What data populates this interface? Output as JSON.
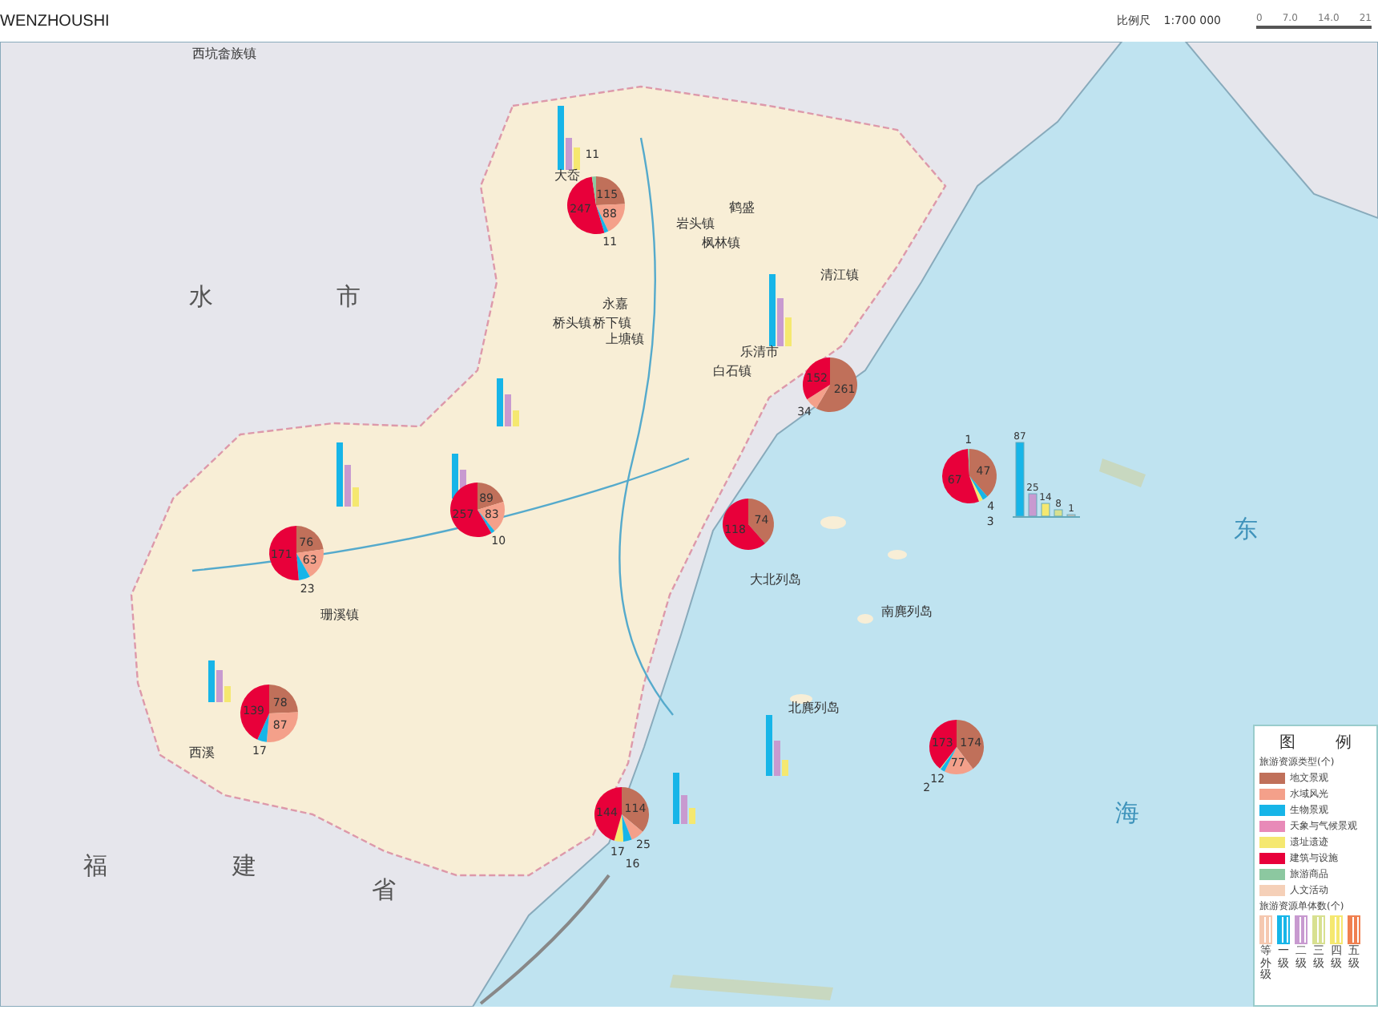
{
  "header": {
    "title": "WENZHOUSHI",
    "scale_label": "比例尺",
    "scale_ratio": "1:700 000",
    "scale_ticks": [
      "0",
      "7.0",
      "14.0",
      "21"
    ]
  },
  "map": {
    "places": [
      {
        "name": "水",
        "kind": "region"
      },
      {
        "name": "市",
        "kind": "region"
      },
      {
        "name": "福",
        "kind": "region"
      },
      {
        "name": "建",
        "kind": "region"
      },
      {
        "name": "省",
        "kind": "region"
      },
      {
        "name": "东",
        "kind": "sea"
      },
      {
        "name": "海",
        "kind": "sea"
      },
      {
        "name": "大岙",
        "kind": "town"
      },
      {
        "name": "岩头镇",
        "kind": "town"
      },
      {
        "name": "枫林镇",
        "kind": "town"
      },
      {
        "name": "鹤盛",
        "kind": "town"
      },
      {
        "name": "桥头镇",
        "kind": "town"
      },
      {
        "name": "桥下镇",
        "kind": "town"
      },
      {
        "name": "永嘉",
        "kind": "town"
      },
      {
        "name": "上塘镇",
        "kind": "town"
      },
      {
        "name": "清江镇",
        "kind": "town"
      },
      {
        "name": "乐清市",
        "kind": "town"
      },
      {
        "name": "白石镇",
        "kind": "town"
      },
      {
        "name": "西坑畲族镇",
        "kind": "town"
      },
      {
        "name": "珊溪镇",
        "kind": "town"
      },
      {
        "name": "西溪",
        "kind": "town"
      },
      {
        "name": "大北列岛",
        "kind": "town"
      },
      {
        "name": "北麂列岛",
        "kind": "town"
      },
      {
        "name": "南麂列岛",
        "kind": "town"
      }
    ],
    "pies": [
      {
        "chart_data": {
          "type": "pie",
          "values": [
            115,
            88,
            11,
            null,
            null,
            247,
            11,
            null
          ],
          "data_labels": true
        }
      },
      {
        "chart_data": {
          "type": "pie",
          "values": [
            261,
            34,
            null,
            null,
            null,
            152,
            null,
            null
          ],
          "data_labels": true
        }
      },
      {
        "chart_data": {
          "type": "pie",
          "values": [
            47,
            null,
            4,
            null,
            3,
            67,
            1,
            null
          ],
          "data_labels": true
        }
      },
      {
        "chart_data": {
          "type": "pie",
          "values": [
            74,
            null,
            null,
            null,
            null,
            118,
            null,
            null
          ],
          "data_labels": true
        }
      },
      {
        "chart_data": {
          "type": "pie",
          "values": [
            89,
            83,
            10,
            null,
            null,
            257,
            null,
            null
          ],
          "data_labels": true
        }
      },
      {
        "chart_data": {
          "type": "pie",
          "values": [
            76,
            63,
            23,
            null,
            null,
            171,
            null,
            null
          ],
          "data_labels": true
        }
      },
      {
        "chart_data": {
          "type": "pie",
          "values": [
            78,
            87,
            17,
            null,
            null,
            139,
            null,
            null
          ],
          "data_labels": true
        }
      },
      {
        "chart_data": {
          "type": "pie",
          "values": [
            114,
            25,
            16,
            null,
            17,
            144,
            null,
            null
          ],
          "data_labels": true
        }
      },
      {
        "chart_data": {
          "type": "pie",
          "values": [
            174,
            77,
            12,
            null,
            2,
            173,
            null,
            null
          ],
          "data_labels": true
        }
      }
    ],
    "bars": [
      {
        "labels": [
          "87",
          "25",
          "14",
          "8",
          "1"
        ]
      }
    ]
  },
  "legend": {
    "title_left": "图",
    "title_right": "例",
    "types_title": "旅游资源类型(个)",
    "types": [
      {
        "label": "地文景观",
        "color": "#c0705a"
      },
      {
        "label": "水域风光",
        "color": "#f4a08a"
      },
      {
        "label": "生物景观",
        "color": "#17b5e8"
      },
      {
        "label": "天象与气候景观",
        "color": "#e88ab8"
      },
      {
        "label": "遗址遗迹",
        "color": "#f5e870"
      },
      {
        "label": "建筑与设施",
        "color": "#e8003a"
      },
      {
        "label": "旅游商品",
        "color": "#8cc8a0"
      },
      {
        "label": "人文活动",
        "color": "#f5d0b8"
      }
    ],
    "levels_title": "旅游资源单体数(个)",
    "levels": [
      {
        "label": "等外级",
        "color": "#f5c8b0"
      },
      {
        "label": "一级",
        "color": "#17b5e8"
      },
      {
        "label": "二级",
        "color": "#c89ad0"
      },
      {
        "label": "三级",
        "color": "#d8e090"
      },
      {
        "label": "四级",
        "color": "#f5e870"
      },
      {
        "label": "五级",
        "color": "#f08050"
      }
    ]
  }
}
